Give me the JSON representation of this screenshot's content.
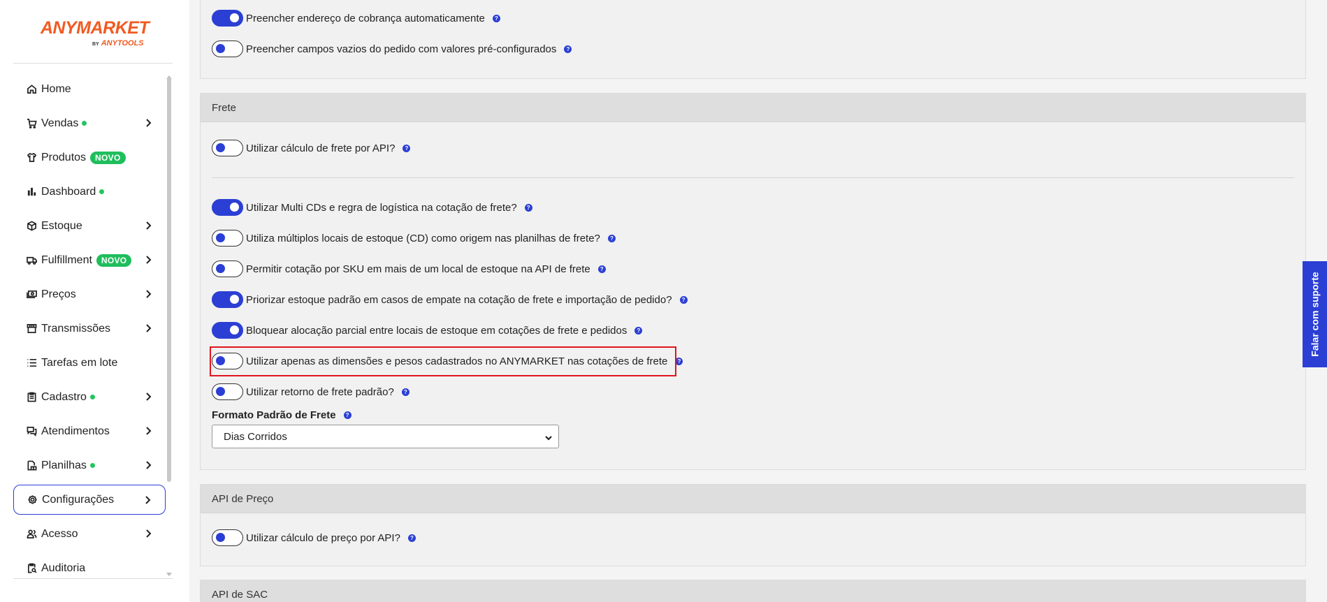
{
  "brand": {
    "name": "ANYMARKET",
    "by": "BY",
    "sub": "ANYTOOLS"
  },
  "sidebar": {
    "items": [
      {
        "label": "Home",
        "icon": "home-icon"
      },
      {
        "label": "Vendas",
        "icon": "cart-icon"
      },
      {
        "label": "Produtos",
        "icon": "shirt-icon",
        "badge": "NOVO"
      },
      {
        "label": "Dashboard",
        "icon": "bar-chart-icon"
      },
      {
        "label": "Estoque",
        "icon": "box-icon"
      },
      {
        "label": "Fulfillment",
        "icon": "truck-icon",
        "badge": "NOVO"
      },
      {
        "label": "Preços",
        "icon": "money-icon"
      },
      {
        "label": "Transmissões",
        "icon": "store-icon"
      },
      {
        "label": "Tarefas em lote",
        "icon": "list-icon"
      },
      {
        "label": "Cadastro",
        "icon": "clipboard-icon"
      },
      {
        "label": "Atendimentos",
        "icon": "chat-icon"
      },
      {
        "label": "Planilhas",
        "icon": "sheet-icon"
      },
      {
        "label": "Configurações",
        "icon": "gear-icon"
      },
      {
        "label": "Acesso",
        "icon": "users-icon"
      },
      {
        "label": "Auditoria",
        "icon": "audit-icon"
      }
    ]
  },
  "top_section": {
    "rows": [
      {
        "label": "Preencher endereço de cobrança automaticamente",
        "on": true
      },
      {
        "label": "Preencher campos vazios do pedido com valores pré-configurados",
        "on": false
      }
    ]
  },
  "frete": {
    "title": "Frete",
    "api_row": {
      "label": "Utilizar cálculo de frete por API?",
      "on": false
    },
    "rows": [
      {
        "label": "Utilizar Multi CDs e regra de logística na cotação de frete?",
        "on": true
      },
      {
        "label": "Utiliza múltiplos locais de estoque (CD) como origem nas planilhas de frete?",
        "on": false
      },
      {
        "label": "Permitir cotação por SKU em mais de um local de estoque na API de frete",
        "on": false
      },
      {
        "label": "Priorizar estoque padrão em casos de empate na cotação de frete e importação de pedido?",
        "on": true
      },
      {
        "label": "Bloquear alocação parcial entre locais de estoque em cotações de frete e pedidos",
        "on": true
      },
      {
        "label": "Utilizar apenas as dimensões e pesos cadastrados no ANYMARKET nas cotações de frete",
        "on": false
      },
      {
        "label": "Utilizar retorno de frete padrão?",
        "on": false
      }
    ],
    "format_label": "Formato Padrão de Frete",
    "format_value": "Dias Corridos"
  },
  "api_preco": {
    "title": "API de Preço",
    "row": {
      "label": "Utilizar cálculo de preço por API?",
      "on": false
    }
  },
  "api_sac": {
    "title": "API de SAC"
  },
  "support_button": "Falar com suporte",
  "colors": {
    "accent": "#2b3fd4",
    "brand": "#f15a22",
    "badge": "#1fbe5c",
    "highlight": "#e0141e"
  }
}
